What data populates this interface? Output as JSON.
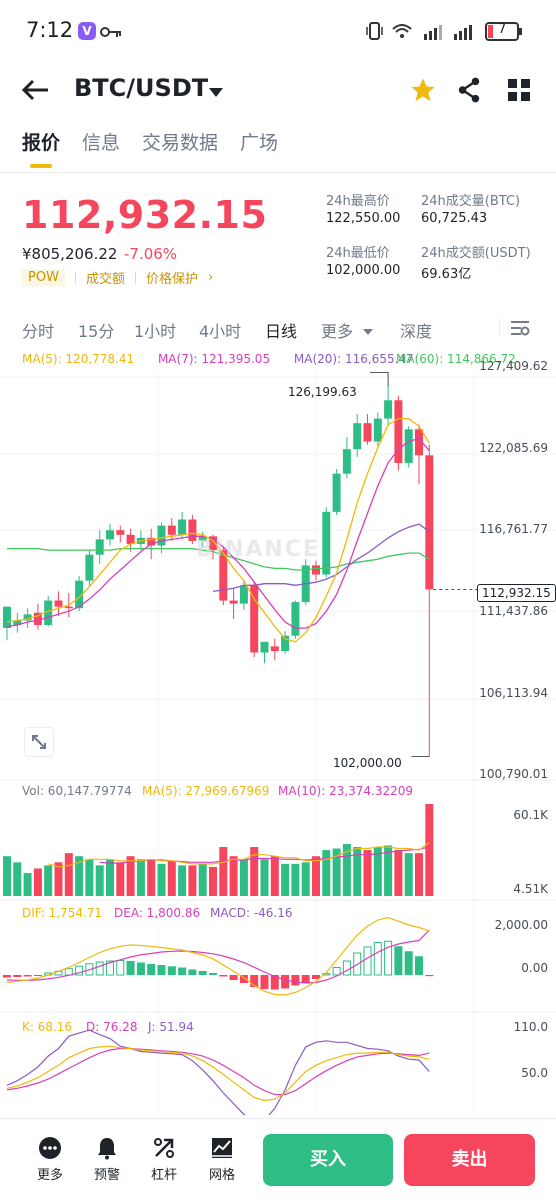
{
  "status_bar": {
    "time": "7:12",
    "app_badge": "V",
    "battery": "7"
  },
  "header": {
    "pair": "BTC/USDT",
    "icons": [
      "back-arrow-icon",
      "caret-down-icon",
      "star-icon",
      "share-icon",
      "grid-icon"
    ],
    "star_color": "#f0b90b"
  },
  "tabs": [
    {
      "label": "报价",
      "active": true
    },
    {
      "label": "信息",
      "active": false
    },
    {
      "label": "交易数据",
      "active": false
    },
    {
      "label": "广场",
      "active": false
    }
  ],
  "price": {
    "last": "112,932.15",
    "fiat": "¥805,206.22",
    "change": "-7.06%",
    "tags": [
      "POW",
      "成交额",
      "价格保护"
    ],
    "tag_arrow": "›"
  },
  "stats": {
    "high_label": "24h最高价",
    "high_value": "122,550.00",
    "vol_btc_label": "24h成交量(BTC)",
    "vol_btc_value": "60,725.43",
    "low_label": "24h最低价",
    "low_value": "102,000.00",
    "vol_usdt_label": "24h成交额(USDT)",
    "vol_usdt_value": "69.63亿"
  },
  "intervals": [
    {
      "label": "分时",
      "active": false
    },
    {
      "label": "15分",
      "active": false
    },
    {
      "label": "1小时",
      "active": false
    },
    {
      "label": "4小时",
      "active": false
    },
    {
      "label": "日线",
      "active": true
    },
    {
      "label": "更多",
      "active": false
    },
    {
      "label": "深度",
      "active": false
    }
  ],
  "ma_legend": {
    "ma5": "MA(5): 120,778.41",
    "ma7": "MA(7): 121,395.05",
    "ma20": "MA(20): 116,655.47",
    "ma60": "MA(60): 114,866.72"
  },
  "price_axis": [
    "127,409.62",
    "122,085.69",
    "116,761.77",
    "111,437.86",
    "106,113.94",
    "100,790.01"
  ],
  "markers": {
    "high": "126,199.63",
    "low": "102,000.00",
    "current": "112,932.15"
  },
  "watermark": "BINANCE",
  "volume_legend": {
    "vol": "Vol: 60,147.79774",
    "ma5": "MA(5): 27,969.67969",
    "ma10": "MA(10): 23,374.32209"
  },
  "volume_axis": [
    "60.1K",
    "4.51K"
  ],
  "macd_legend": {
    "dif": "DIF: 1,754.71",
    "dea": "DEA: 1,800.86",
    "macd": "MACD: -46.16"
  },
  "macd_axis": [
    "2,000.00",
    "0.00"
  ],
  "kdj_legend": {
    "k": "K: 68.16",
    "d": "D: 76.28",
    "j": "J: 51.94"
  },
  "kdj_axis": [
    "110.0",
    "50.0"
  ],
  "bottom_nav": [
    {
      "label": "更多",
      "icon": "more-dots-icon"
    },
    {
      "label": "预警",
      "icon": "bell-icon"
    },
    {
      "label": "杠杆",
      "icon": "leverage-icon"
    },
    {
      "label": "网格",
      "icon": "grid-chart-icon"
    }
  ],
  "actions": {
    "buy": "买入",
    "sell": "卖出"
  },
  "colors": {
    "up": "#2ebd85",
    "down": "#f6465d",
    "ma5": "#f0b90b",
    "ma7": "#d63fba",
    "ma20": "#8a5cc5",
    "ma60": "#41c75b",
    "accent": "#f0b90b"
  },
  "chart_data": {
    "type": "candlestick",
    "interval": "日线",
    "candles": [
      {
        "o": 110400,
        "h": 111600,
        "c": 111800,
        "l": 109600
      },
      {
        "o": 110600,
        "h": 111400,
        "c": 110900,
        "l": 110100
      },
      {
        "o": 110900,
        "h": 111700,
        "c": 111300,
        "l": 110400
      },
      {
        "o": 111400,
        "h": 112000,
        "c": 110600,
        "l": 110300
      },
      {
        "o": 110600,
        "h": 112500,
        "c": 112200,
        "l": 110500
      },
      {
        "o": 112200,
        "h": 112800,
        "c": 111800,
        "l": 111200
      },
      {
        "o": 111800,
        "h": 112700,
        "c": 111700,
        "l": 111100
      },
      {
        "o": 111700,
        "h": 113800,
        "c": 113500,
        "l": 111500
      },
      {
        "o": 113500,
        "h": 115500,
        "c": 115200,
        "l": 113100
      },
      {
        "o": 115200,
        "h": 116800,
        "c": 116200,
        "l": 114600
      },
      {
        "o": 116200,
        "h": 117200,
        "c": 116800,
        "l": 115800
      },
      {
        "o": 116800,
        "h": 117100,
        "c": 116500,
        "l": 116000
      },
      {
        "o": 116500,
        "h": 116900,
        "c": 115900,
        "l": 115400
      },
      {
        "o": 115900,
        "h": 116800,
        "c": 116300,
        "l": 115500
      },
      {
        "o": 116300,
        "h": 116900,
        "c": 115800,
        "l": 114900
      },
      {
        "o": 115800,
        "h": 117300,
        "c": 117100,
        "l": 115300
      },
      {
        "o": 117100,
        "h": 117600,
        "c": 116500,
        "l": 116100
      },
      {
        "o": 116500,
        "h": 118000,
        "c": 117500,
        "l": 116200
      },
      {
        "o": 117500,
        "h": 117800,
        "c": 116100,
        "l": 115900
      },
      {
        "o": 116100,
        "h": 116700,
        "c": 116400,
        "l": 115700
      },
      {
        "o": 116400,
        "h": 116500,
        "c": 115500,
        "l": 114900
      },
      {
        "o": 115500,
        "h": 115700,
        "c": 112200,
        "l": 111900
      },
      {
        "o": 112200,
        "h": 113000,
        "c": 112000,
        "l": 111000
      },
      {
        "o": 112000,
        "h": 113500,
        "c": 113200,
        "l": 111600
      },
      {
        "o": 113200,
        "h": 113400,
        "c": 108800,
        "l": 108500
      },
      {
        "o": 108800,
        "h": 109500,
        "c": 109500,
        "l": 108100
      },
      {
        "o": 109200,
        "h": 109700,
        "c": 108900,
        "l": 108300
      },
      {
        "o": 108900,
        "h": 110200,
        "c": 109900,
        "l": 108700
      },
      {
        "o": 109900,
        "h": 112200,
        "c": 112100,
        "l": 109700
      },
      {
        "o": 112100,
        "h": 114900,
        "c": 114500,
        "l": 111900
      },
      {
        "o": 114500,
        "h": 114800,
        "c": 113900,
        "l": 113500
      },
      {
        "o": 113900,
        "h": 118300,
        "c": 118000,
        "l": 113700
      },
      {
        "o": 118000,
        "h": 120800,
        "c": 120500,
        "l": 117800
      },
      {
        "o": 120500,
        "h": 122900,
        "c": 122100,
        "l": 120200
      },
      {
        "o": 122100,
        "h": 124400,
        "c": 123800,
        "l": 121600
      },
      {
        "o": 123800,
        "h": 124400,
        "c": 122600,
        "l": 122400
      },
      {
        "o": 122600,
        "h": 124500,
        "c": 124100,
        "l": 122300
      },
      {
        "o": 124100,
        "h": 126200,
        "c": 125300,
        "l": 123600
      },
      {
        "o": 125300,
        "h": 125600,
        "c": 121200,
        "l": 120700
      },
      {
        "o": 121200,
        "h": 123600,
        "c": 123400,
        "l": 120900
      },
      {
        "o": 123400,
        "h": 123700,
        "c": 121700,
        "l": 119800
      },
      {
        "o": 121700,
        "h": 122400,
        "c": 112932,
        "l": 102000
      }
    ],
    "ma5": [
      110800,
      110900,
      111000,
      111200,
      111500,
      111700,
      111900,
      112400,
      113100,
      113900,
      114700,
      115500,
      115900,
      116100,
      116200,
      116300,
      116400,
      116500,
      116600,
      116500,
      116100,
      115300,
      114300,
      113500,
      112300,
      111400,
      110500,
      109700,
      109500,
      110100,
      111100,
      112500,
      114000,
      116200,
      118600,
      120500,
      122200,
      123700,
      124100,
      124100,
      123600,
      122500
    ],
    "ma7": [
      110500,
      110600,
      110800,
      110900,
      111100,
      111300,
      111500,
      111800,
      112300,
      112900,
      113600,
      114200,
      114800,
      115400,
      115900,
      116100,
      116200,
      116300,
      116400,
      116400,
      116200,
      115700,
      115000,
      114300,
      113400,
      112500,
      111600,
      110800,
      110400,
      110400,
      110700,
      111500,
      112600,
      114200,
      116100,
      117900,
      119700,
      121200,
      122100,
      122600,
      122800,
      122000
    ],
    "ma20": [
      null,
      null,
      null,
      null,
      null,
      null,
      null,
      null,
      null,
      null,
      null,
      null,
      null,
      null,
      null,
      null,
      null,
      null,
      null,
      null,
      112800,
      112900,
      113000,
      113200,
      113200,
      113300,
      113300,
      113300,
      113200,
      113300,
      113400,
      113600,
      113900,
      114400,
      114900,
      115300,
      115800,
      116300,
      116700,
      117000,
      117200,
      116700
    ],
    "ma60": [
      115600,
      115600,
      115600,
      115600,
      115500,
      115500,
      115500,
      115500,
      115500,
      115500,
      115500,
      115600,
      115600,
      115600,
      115600,
      115600,
      115600,
      115600,
      115600,
      115500,
      115400,
      115200,
      115000,
      114800,
      114600,
      114400,
      114300,
      114300,
      114200,
      114200,
      114300,
      114300,
      114400,
      114600,
      114700,
      114800,
      114900,
      115100,
      115200,
      115300,
      115300,
      114900
    ],
    "volume": [
      26000,
      22000,
      15000,
      18000,
      20000,
      22000,
      28000,
      26000,
      24000,
      20000,
      24000,
      22000,
      26000,
      24000,
      24000,
      21000,
      23000,
      20000,
      20000,
      21000,
      19000,
      32000,
      26000,
      24000,
      32000,
      24000,
      26000,
      21000,
      21000,
      22000,
      26000,
      30000,
      31000,
      34000,
      32000,
      30000,
      32000,
      33000,
      30000,
      28000,
      28000,
      60100
    ],
    "vol_ma5": [
      null,
      null,
      null,
      null,
      21000,
      19000,
      20000,
      22000,
      24000,
      24000,
      24000,
      23000,
      23000,
      23000,
      24000,
      23000,
      23000,
      22000,
      21000,
      21000,
      21000,
      22000,
      24000,
      24000,
      27000,
      27000,
      26000,
      25000,
      25000,
      23000,
      23000,
      24000,
      26000,
      29000,
      31000,
      31000,
      32000,
      32000,
      31000,
      31000,
      30000,
      35000
    ],
    "vol_ma10": [
      null,
      null,
      null,
      null,
      null,
      null,
      null,
      null,
      null,
      22000,
      21500,
      21500,
      22500,
      23000,
      23500,
      23500,
      23000,
      22500,
      22000,
      22000,
      22000,
      23000,
      23500,
      23500,
      24500,
      24500,
      24500,
      24000,
      24000,
      23500,
      24000,
      24500,
      25500,
      26000,
      27000,
      27000,
      27500,
      28500,
      29500,
      30000,
      30500,
      32000
    ],
    "macd_hist": [
      -100,
      -80,
      -60,
      -20,
      80,
      150,
      250,
      350,
      450,
      520,
      560,
      580,
      560,
      500,
      440,
      400,
      350,
      300,
      220,
      160,
      80,
      -60,
      -200,
      -320,
      -480,
      -560,
      -580,
      -540,
      -420,
      -300,
      -160,
      60,
      300,
      560,
      880,
      1120,
      1300,
      1350,
      1150,
      950,
      750,
      -46
    ],
    "dif": [
      -300,
      -250,
      -200,
      -120,
      0,
      150,
      300,
      500,
      700,
      900,
      1050,
      1150,
      1200,
      1180,
      1150,
      1100,
      1050,
      1000,
      900,
      800,
      650,
      400,
      150,
      -100,
      -420,
      -650,
      -780,
      -800,
      -700,
      -500,
      -260,
      100,
      600,
      1100,
      1600,
      1950,
      2200,
      2300,
      2150,
      2000,
      1900,
      1755
    ],
    "dea": [
      -200,
      -210,
      -210,
      -195,
      -155,
      -90,
      -10,
      90,
      210,
      350,
      500,
      610,
      720,
      810,
      860,
      920,
      950,
      960,
      940,
      900,
      850,
      760,
      640,
      500,
      310,
      120,
      -60,
      -200,
      -280,
      -320,
      -300,
      -200,
      -40,
      180,
      420,
      680,
      910,
      1110,
      1240,
      1320,
      1380,
      1801
    ],
    "k": [
      30,
      33,
      38,
      44,
      52,
      60,
      70,
      76,
      82,
      84,
      85,
      83,
      82,
      80,
      79,
      78,
      77,
      76,
      72,
      66,
      58,
      48,
      38,
      28,
      18,
      14,
      16,
      24,
      38,
      52,
      60,
      66,
      70,
      74,
      76,
      76,
      77,
      77,
      74,
      72,
      71,
      68
    ],
    "d": [
      28,
      30,
      33,
      37,
      42,
      49,
      56,
      63,
      70,
      76,
      80,
      82,
      82,
      81,
      80,
      79,
      78,
      77,
      75,
      72,
      67,
      60,
      52,
      44,
      34,
      27,
      22,
      22,
      27,
      36,
      45,
      53,
      60,
      66,
      71,
      73,
      75,
      76,
      75,
      74,
      73,
      76
    ],
    "j": [
      34,
      40,
      48,
      58,
      72,
      82,
      98,
      102,
      106,
      100,
      95,
      85,
      82,
      78,
      77,
      76,
      75,
      74,
      66,
      54,
      40,
      24,
      10,
      -4,
      -14,
      -12,
      4,
      28,
      60,
      84,
      90,
      92,
      90,
      90,
      86,
      82,
      81,
      79,
      72,
      68,
      67,
      52
    ]
  }
}
